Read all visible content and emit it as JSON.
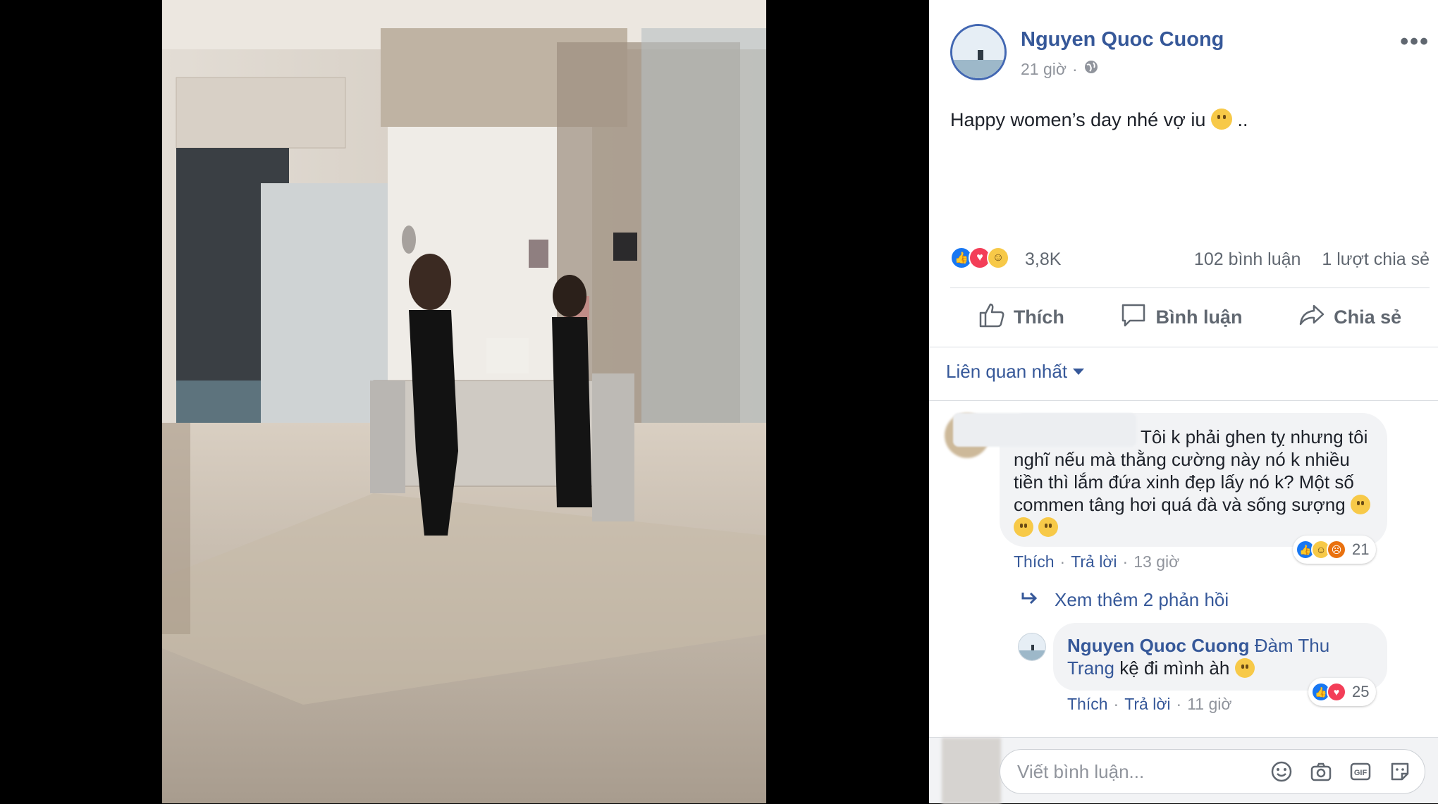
{
  "post": {
    "author": "Nguyen Quoc Cuong",
    "time": "21 giờ",
    "separator": "·",
    "text": "Happy women’s day nhé vợ iu",
    "text_suffix": "..",
    "reaction_count": "3,8K",
    "comment_count": "102 bình luận",
    "share_count": "1 lượt chia sẻ"
  },
  "actions": {
    "like": "Thích",
    "comment": "Bình luận",
    "share": "Chia sẻ"
  },
  "sort_label": "Liên quan nhất",
  "comments": [
    {
      "text": "Tôi k phải ghen tỵ nhưng tôi nghĩ nếu mà thằng cường này nó k nhiều tiền thì lắm đứa xinh đẹp lấy nó k? Một số commen tâng hơi quá đà và sống sượng",
      "like": "Thích",
      "reply": "Trả lời",
      "time": "13 giờ",
      "reactions": "21"
    }
  ],
  "view_replies": "Xem thêm 2 phản hồi",
  "reply": {
    "author": "Nguyen Quoc Cuong",
    "tag": "Đàm Thu Trang",
    "text": "kệ đi mình àh",
    "like": "Thích",
    "reply": "Trả lời",
    "time": "11 giờ",
    "reactions": "25"
  },
  "composer": {
    "placeholder": "Viết bình luận..."
  },
  "icons": [
    "globe-icon",
    "more-icon",
    "like-icon",
    "comment-icon",
    "share-icon",
    "reply-arrow-icon",
    "emoji-icon",
    "camera-icon",
    "gif-icon",
    "sticker-icon"
  ]
}
